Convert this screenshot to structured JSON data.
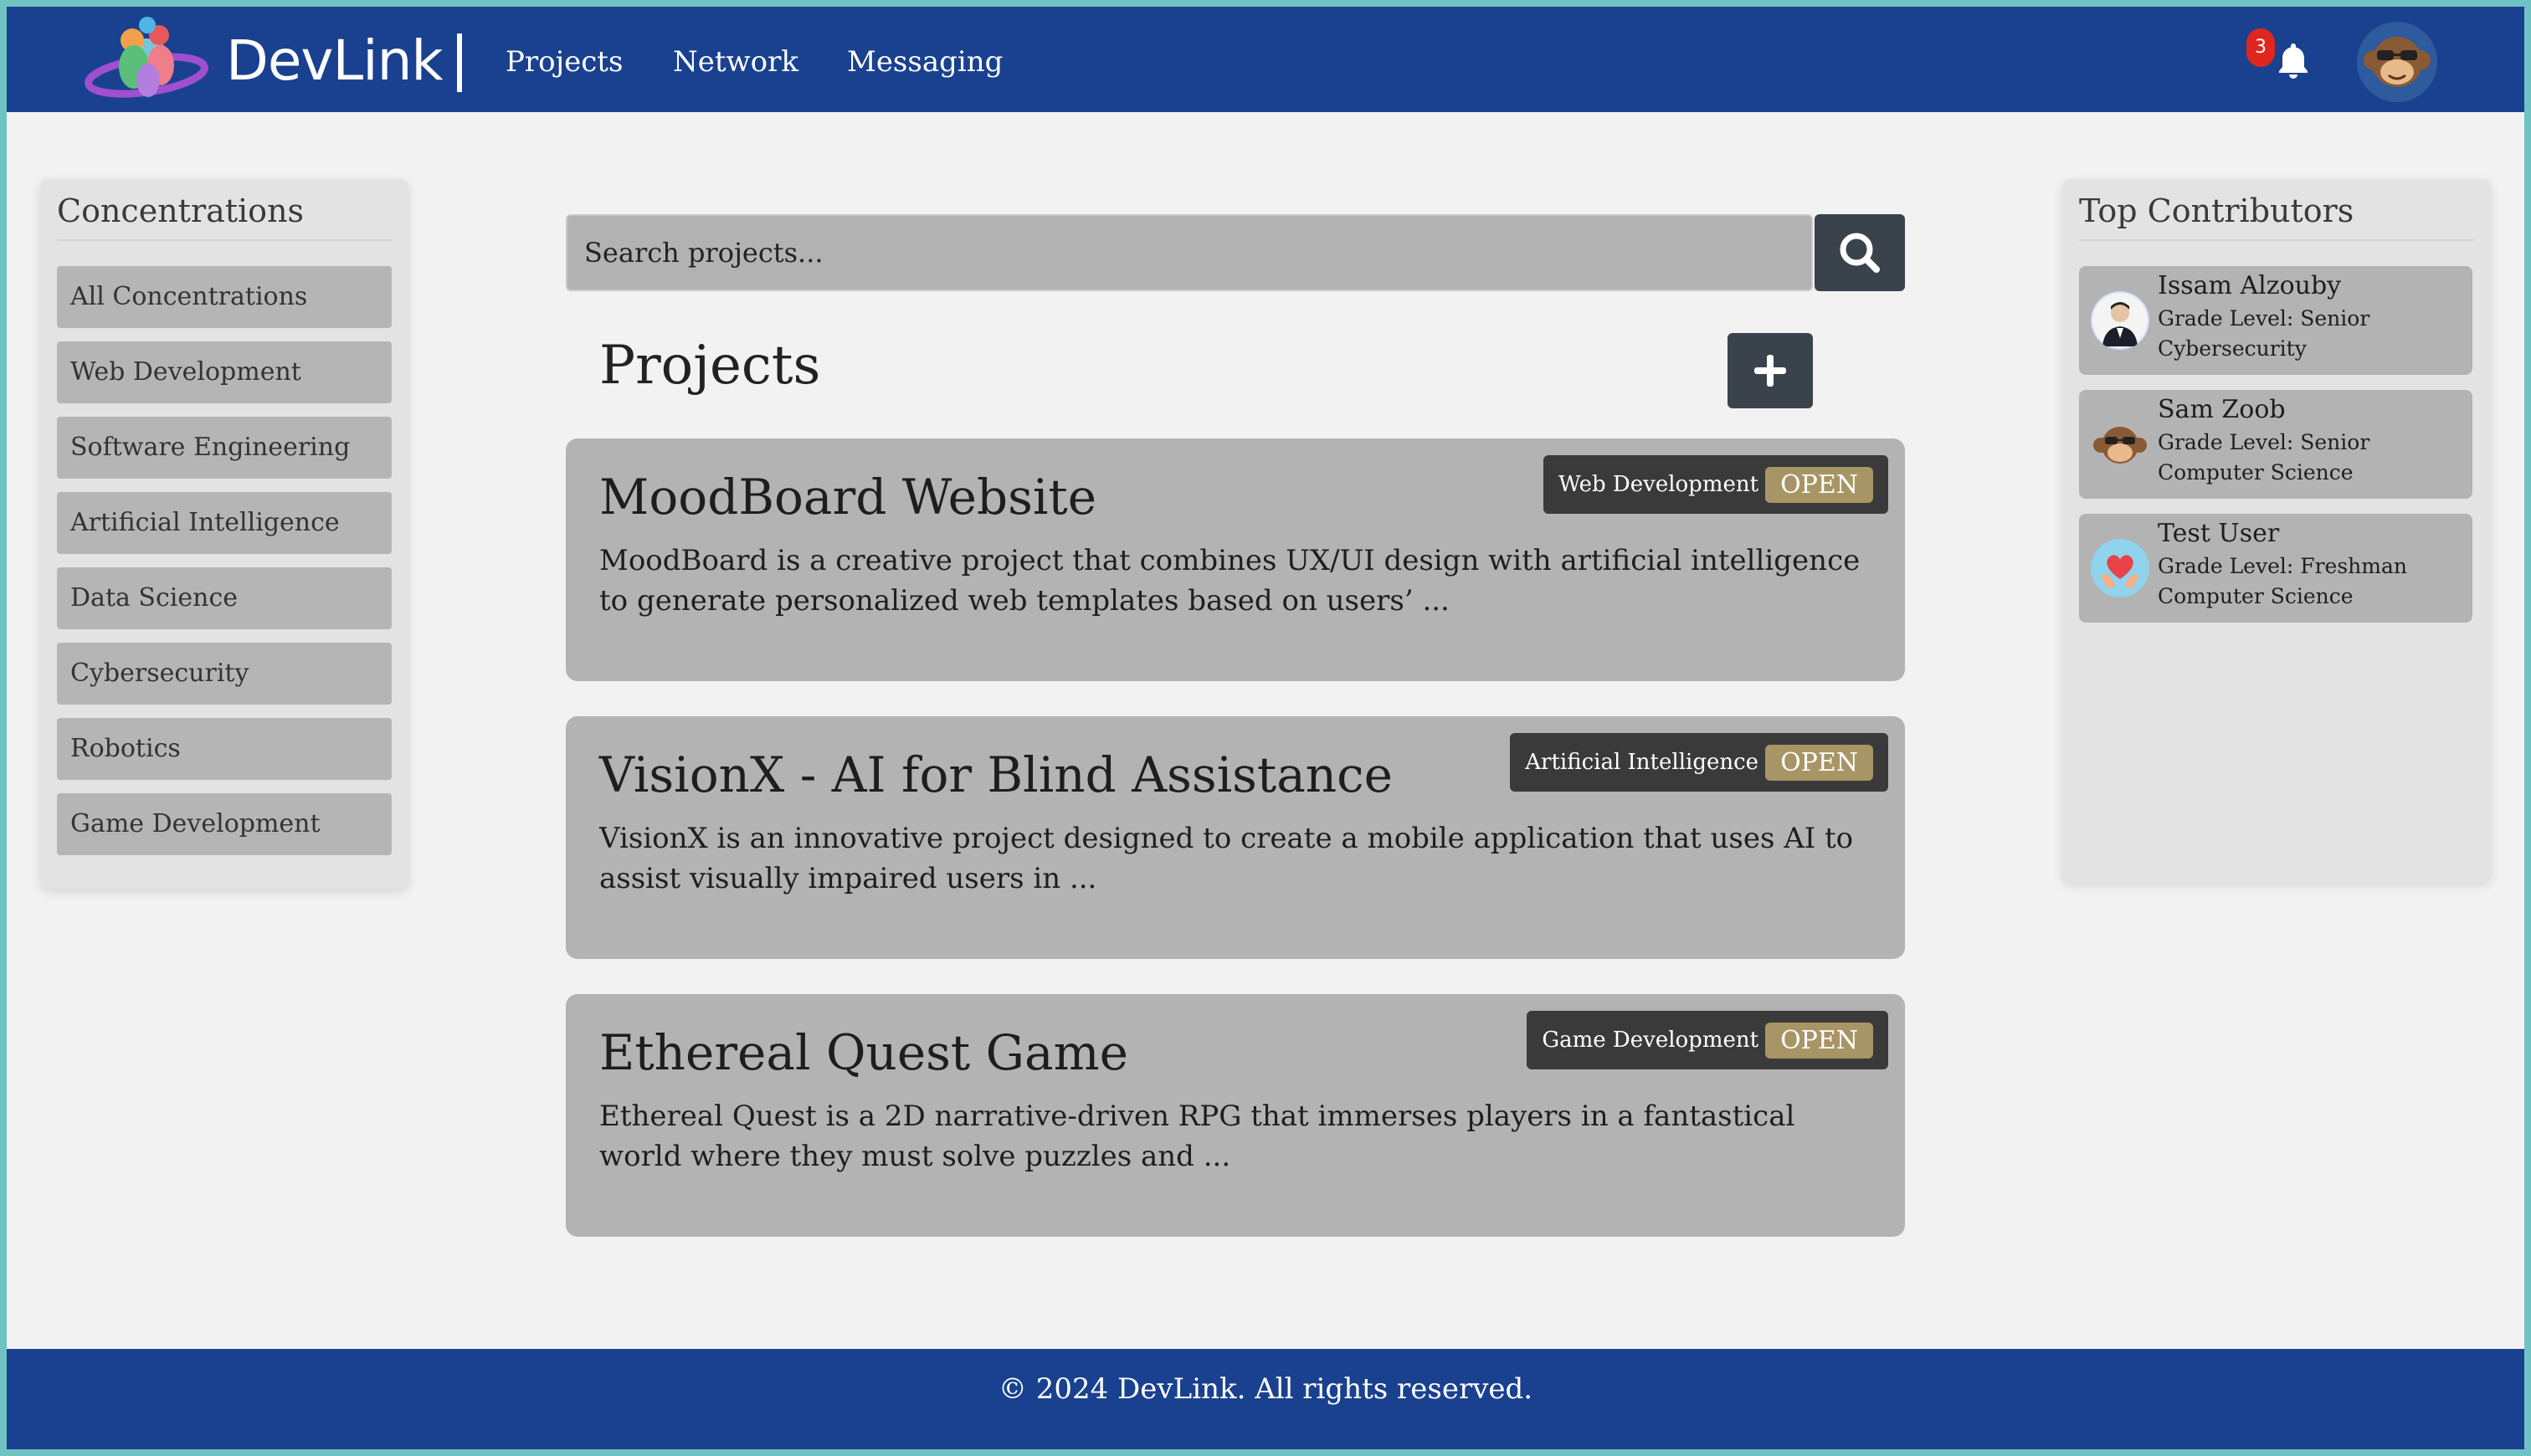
{
  "brand": {
    "name": "DevLink",
    "logo_icon": "planet-people-logo"
  },
  "nav": {
    "links": [
      "Projects",
      "Network",
      "Messaging"
    ],
    "notification_count": "3",
    "bell_icon": "bell-icon",
    "avatar_icon": "monkey-avatar"
  },
  "sidebar": {
    "title": "Concentrations",
    "items": [
      "All Concentrations",
      "Web Development",
      "Software Engineering",
      "Artificial Intelligence",
      "Data Science",
      "Cybersecurity",
      "Robotics",
      "Game Development"
    ]
  },
  "search": {
    "placeholder": "Search projects...",
    "value": "",
    "icon": "search-icon"
  },
  "main": {
    "heading": "Projects",
    "add_icon": "plus-icon",
    "projects": [
      {
        "title": "MoodBoard Website",
        "description": "MoodBoard is a creative project that combines UX/UI design with artificial intelligence to generate personalized web templates based on users’ ...",
        "category": "Web Development",
        "status": "OPEN"
      },
      {
        "title": "VisionX - AI for Blind Assistance",
        "description": "VisionX is an innovative project designed to create a mobile application that uses AI to assist visually impaired users in ...",
        "category": "Artificial Intelligence",
        "status": "OPEN"
      },
      {
        "title": "Ethereal Quest Game",
        "description": "Ethereal Quest is a 2D narrative-driven RPG that immerses players in a fantastical world where they must solve puzzles and ...",
        "category": "Game Development",
        "status": "OPEN"
      }
    ]
  },
  "contributors": {
    "title": "Top Contributors",
    "people": [
      {
        "name": "Issam Alzouby",
        "grade": "Grade Level: Senior",
        "concentration": "Cybersecurity",
        "avatar": "person-photo-avatar"
      },
      {
        "name": "Sam Zoob",
        "grade": "Grade Level: Senior",
        "concentration": "Computer Science",
        "avatar": "monkey-avatar"
      },
      {
        "name": "Test User",
        "grade": "Grade Level: Freshman",
        "concentration": "Computer Science",
        "avatar": "heart-hands-avatar"
      }
    ]
  },
  "footer": {
    "text": "© 2024 DevLink. All rights reserved."
  },
  "colors": {
    "navbar": "#19418f",
    "page_bg": "#f2f2f2",
    "card_bg": "#b3b3b3",
    "button_dark": "#3a434c",
    "status_badge": "#a89565",
    "notification_badge": "#e0261e"
  }
}
